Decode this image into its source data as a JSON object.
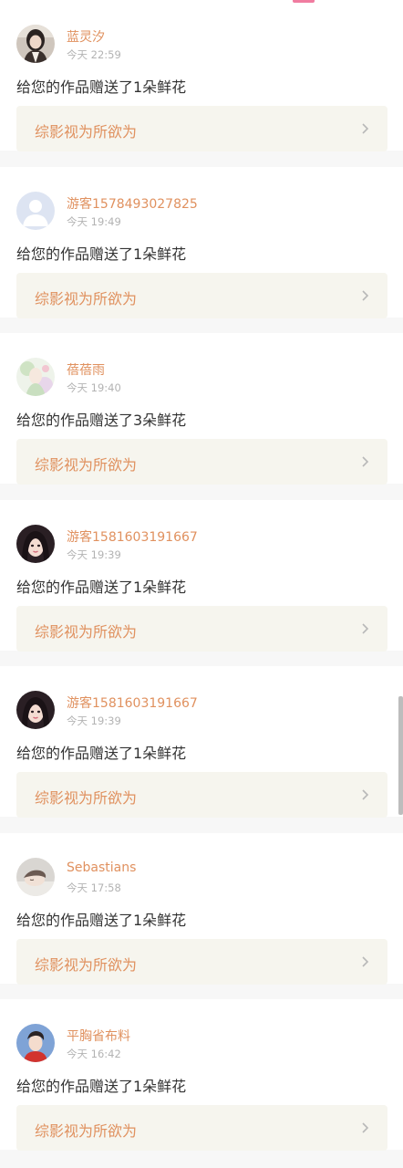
{
  "notifications": [
    {
      "user_name": "蓝灵汐",
      "time": "今天 22:59",
      "message": "给您的作品赠送了1朵鲜花",
      "work_title": "综影视为所欲为",
      "avatar": "girl-photo-avatar"
    },
    {
      "user_name": "游客1578493027825",
      "time": "今天 19:49",
      "message": "给您的作品赠送了1朵鲜花",
      "work_title": "综影视为所欲为",
      "avatar": "default-user-avatar"
    },
    {
      "user_name": "蓓蓓雨",
      "time": "今天 19:40",
      "message": "给您的作品赠送了3朵鲜花",
      "work_title": "综影视为所欲为",
      "avatar": "pastel-illustration-avatar"
    },
    {
      "user_name": "游客1581603191667",
      "time": "今天 19:39",
      "message": "给您的作品赠送了1朵鲜花",
      "work_title": "综影视为所欲为",
      "avatar": "dark-hair-girl-avatar"
    },
    {
      "user_name": "游客1581603191667",
      "time": "今天 19:39",
      "message": "给您的作品赠送了1朵鲜花",
      "work_title": "综影视为所欲为",
      "avatar": "dark-hair-girl-avatar"
    },
    {
      "user_name": "Sebastians",
      "time": "今天 17:58",
      "message": "给您的作品赠送了1朵鲜花",
      "work_title": "综影视为所欲为",
      "avatar": "sleeping-person-avatar"
    },
    {
      "user_name": "平胸省布料",
      "time": "今天 16:42",
      "message": "给您的作品赠送了1朵鲜花",
      "work_title": "综影视为所欲为",
      "avatar": "red-shirt-boy-avatar"
    }
  ],
  "colors": {
    "accent": "#e0915f",
    "link_bg": "#f6f5ee",
    "text": "#333333",
    "muted": "#b3b3b3",
    "indicator": "#f07ca0"
  },
  "icons": {
    "chevron": "chevron-right-icon"
  }
}
